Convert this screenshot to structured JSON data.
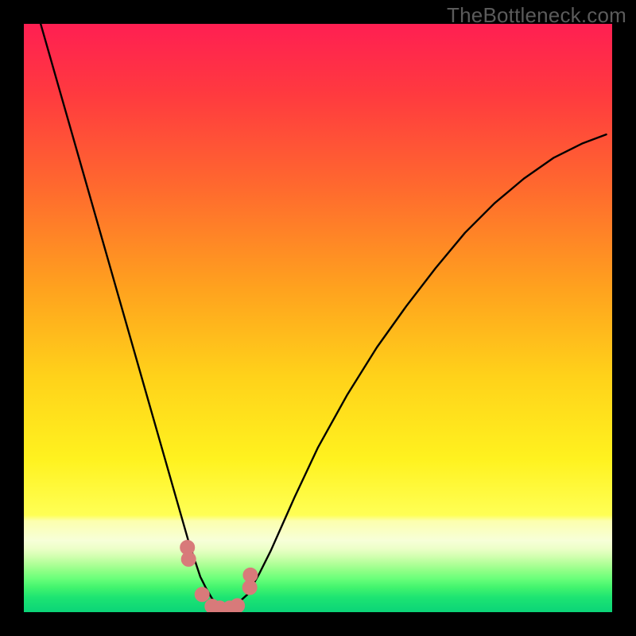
{
  "watermark": "TheBottleneck.com",
  "colors": {
    "frame": "#000000",
    "curve": "#000000",
    "marker_fill": "#d87a7a",
    "marker_stroke": "#d87a7a",
    "gradient_stops": [
      {
        "offset": 0.0,
        "color": "#ff1f52"
      },
      {
        "offset": 0.12,
        "color": "#ff3a3f"
      },
      {
        "offset": 0.28,
        "color": "#ff6a2e"
      },
      {
        "offset": 0.45,
        "color": "#ffa21e"
      },
      {
        "offset": 0.6,
        "color": "#ffd21a"
      },
      {
        "offset": 0.74,
        "color": "#fff21f"
      },
      {
        "offset": 0.835,
        "color": "#ffff55"
      },
      {
        "offset": 0.845,
        "color": "#fcffae"
      },
      {
        "offset": 0.878,
        "color": "#f7ffd8"
      },
      {
        "offset": 0.892,
        "color": "#ecffc8"
      },
      {
        "offset": 0.905,
        "color": "#d2ffb0"
      },
      {
        "offset": 0.918,
        "color": "#b0ff98"
      },
      {
        "offset": 0.93,
        "color": "#8eff86"
      },
      {
        "offset": 0.943,
        "color": "#6aff7a"
      },
      {
        "offset": 0.958,
        "color": "#42f46e"
      },
      {
        "offset": 0.975,
        "color": "#1de472"
      },
      {
        "offset": 1.0,
        "color": "#0bd478"
      }
    ]
  },
  "chart_data": {
    "type": "line",
    "title": "",
    "xlabel": "",
    "ylabel": "",
    "xlim": [
      0,
      100
    ],
    "ylim": [
      0,
      100
    ],
    "series": [
      {
        "name": "curve",
        "x": [
          0,
          2,
          4,
          6,
          8,
          10,
          12,
          14,
          16,
          18,
          20,
          22,
          24,
          26,
          28,
          30,
          31,
          32,
          33,
          34,
          35,
          36,
          38,
          40,
          42,
          44,
          46,
          50,
          55,
          60,
          65,
          70,
          75,
          80,
          85,
          90,
          95,
          99
        ],
        "y": [
          110,
          103,
          96,
          89,
          82,
          75,
          68,
          61,
          54,
          47,
          40,
          33,
          26,
          19,
          12,
          6,
          4,
          2.3,
          1.3,
          0.8,
          0.8,
          1.2,
          3.0,
          6.5,
          10.5,
          15,
          19.5,
          28,
          37,
          45,
          52,
          58.5,
          64.5,
          69.5,
          73.7,
          77.2,
          79.7,
          81.2
        ]
      }
    ],
    "markers": {
      "name": "near-minimum-points",
      "x": [
        27.8,
        28.0,
        30.3,
        32.0,
        33.3,
        35.0,
        36.3,
        38.4,
        38.5
      ],
      "y": [
        11.0,
        9.0,
        3.0,
        1.0,
        0.7,
        0.7,
        1.1,
        4.2,
        6.3
      ],
      "r": 9
    }
  }
}
